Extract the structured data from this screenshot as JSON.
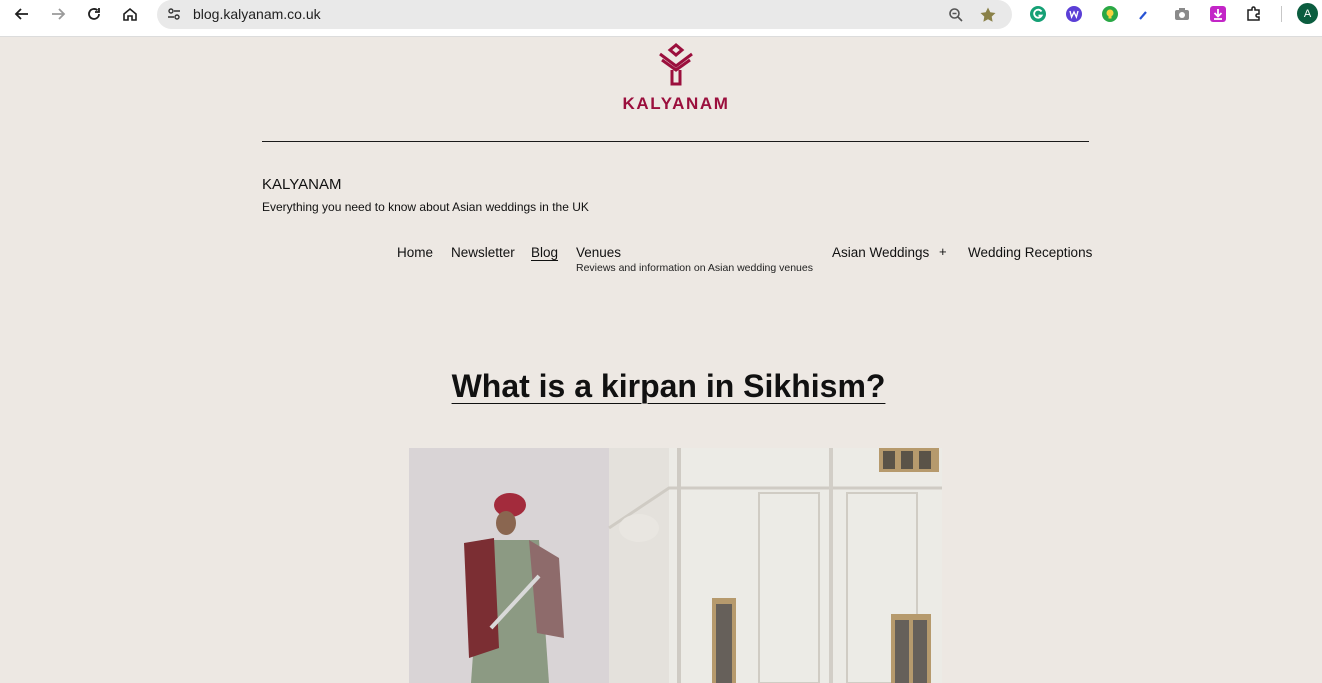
{
  "browser": {
    "url": "blog.kalyanam.co.uk",
    "profile_initial": "A",
    "icons": {
      "back": "back-arrow-icon",
      "forward": "forward-arrow-icon",
      "reload": "reload-icon",
      "home": "home-icon",
      "site_info": "site-info-icon",
      "zoom": "zoom-icon",
      "bookmark": "star-icon"
    },
    "extensions": [
      "grammarly-icon",
      "extension-w-icon",
      "lightbulb-icon",
      "pen-icon",
      "camera-icon",
      "download-icon",
      "puzzle-icon"
    ]
  },
  "site": {
    "logo_text": "KALYANAM",
    "title": "KALYANAM",
    "tagline": "Everything you need to know about Asian weddings in the UK",
    "brand_color": "#9b0f3d",
    "background": "#ede8e3"
  },
  "menu": {
    "home": "Home",
    "newsletter": "Newsletter",
    "blog": "Blog",
    "venues": "Venues",
    "venues_desc": "Reviews and information on Asian wedding venues",
    "asian_weddings": "Asian Weddings",
    "submenu_toggle": "+",
    "wedding_receptions": "Wedding Receptions"
  },
  "post": {
    "title": "What is a kirpan in Sikhism?"
  }
}
